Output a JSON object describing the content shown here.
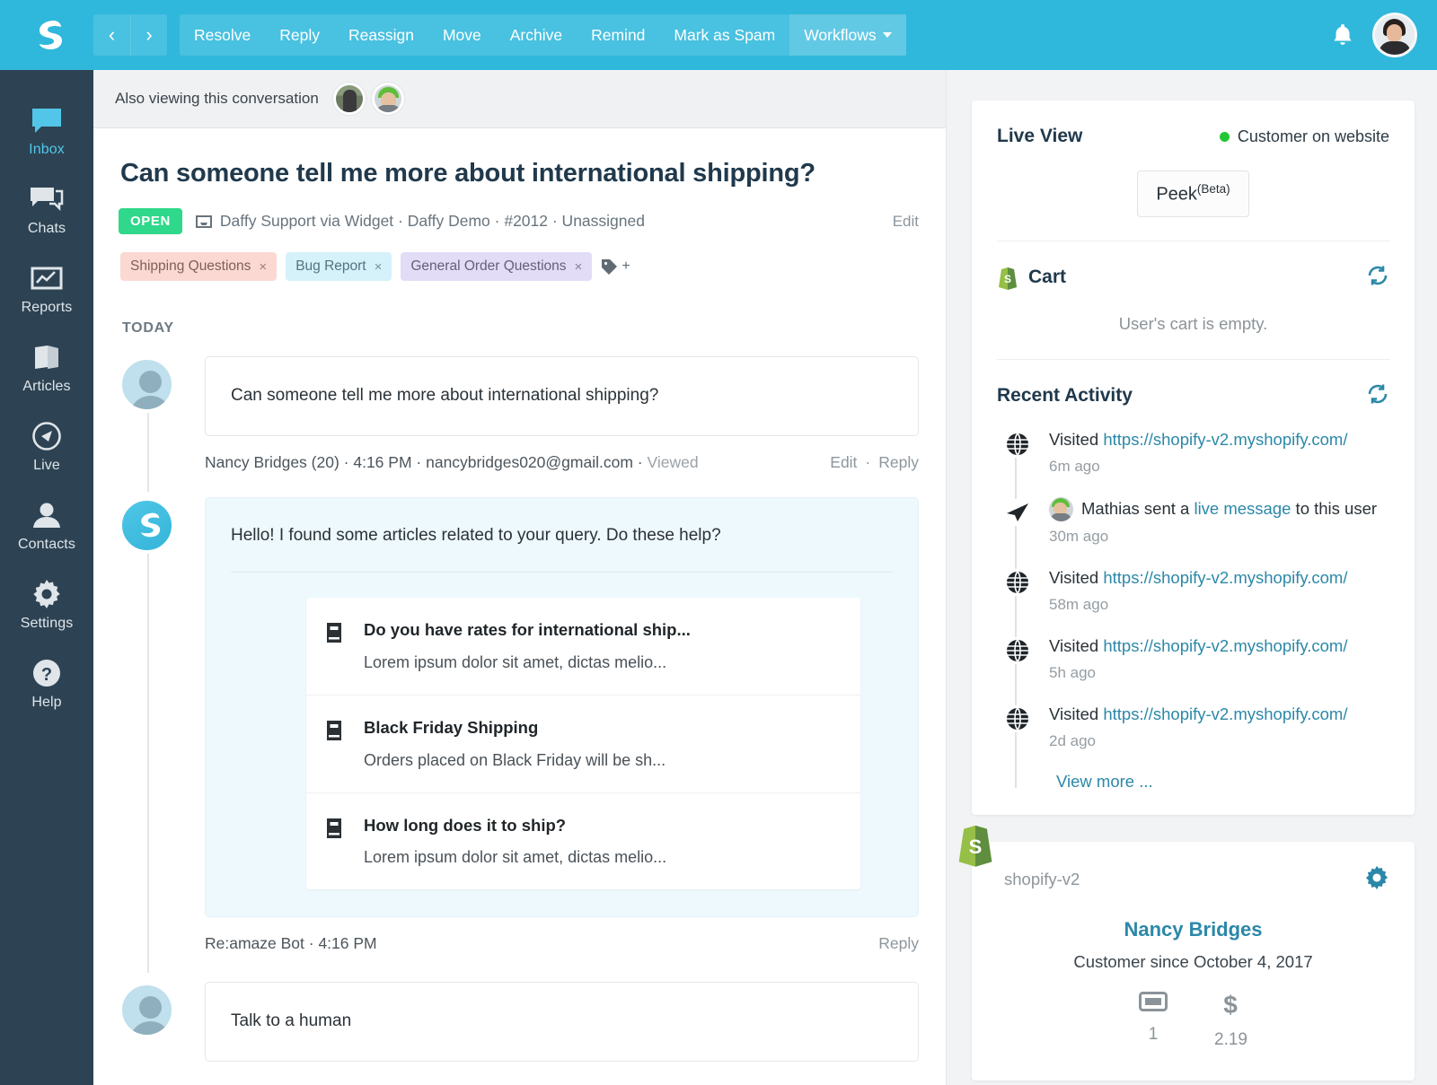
{
  "topbar": {
    "logo_icon": "reamaze-logo-icon",
    "prev_label": "‹",
    "next_label": "›",
    "actions": [
      {
        "label": "Resolve",
        "name": "resolve"
      },
      {
        "label": "Reply",
        "name": "reply"
      },
      {
        "label": "Reassign",
        "name": "reassign"
      },
      {
        "label": "Move",
        "name": "move"
      },
      {
        "label": "Archive",
        "name": "archive"
      },
      {
        "label": "Remind",
        "name": "remind"
      },
      {
        "label": "Mark as Spam",
        "name": "mark-as-spam"
      },
      {
        "label": "Workflows",
        "name": "workflows"
      }
    ],
    "bell_icon": "bell-icon",
    "avatar_icon": "user-avatar",
    "bg_color": "#2fb8dc"
  },
  "sidebar": {
    "bg_color": "#2d4354",
    "active_color": "#52c6e8",
    "items": [
      {
        "label": "Inbox",
        "icon": "inbox-chat-icon",
        "active": true
      },
      {
        "label": "Chats",
        "icon": "chats-icon",
        "active": false
      },
      {
        "label": "Reports",
        "icon": "reports-chart-icon",
        "active": false
      },
      {
        "label": "Articles",
        "icon": "articles-book-icon",
        "active": false
      },
      {
        "label": "Live",
        "icon": "live-compass-icon",
        "active": false
      },
      {
        "label": "Contacts",
        "icon": "contacts-person-icon",
        "active": false
      },
      {
        "label": "Settings",
        "icon": "gear-icon",
        "active": false
      },
      {
        "label": "Help",
        "icon": "help-question-icon",
        "active": false
      }
    ]
  },
  "viewing": {
    "label": "Also viewing this conversation",
    "viewer_count": 2
  },
  "conversation": {
    "title": "Can someone tell me more about international shipping?",
    "status_badge": "OPEN",
    "status_color": "#2fd88a",
    "meta": "Daffy Support via Widget · Daffy Demo · #2012 · Unassigned",
    "meta_icon": "inbox-tray-icon",
    "edit_label": "Edit",
    "tags": [
      {
        "label": "Shipping Questions",
        "bg": "#fbd9d2",
        "fg": "#7d6058",
        "close": "×"
      },
      {
        "label": "Bug Report",
        "bg": "#d5f1fa",
        "fg": "#52747f",
        "close": "×"
      },
      {
        "label": "General Order Questions",
        "bg": "#e3dcf7",
        "fg": "#645f7a",
        "close": "×"
      }
    ],
    "tag_add_icon": "tag-plus-icon",
    "tag_add_label": "+",
    "day_separator": "TODAY",
    "messages": [
      {
        "type": "customer",
        "avatar_icon": "customer-avatar",
        "text": "Can someone tell me more about international shipping?",
        "author": "Nancy Bridges (20)",
        "time": "4:16 PM",
        "email": "nancybridges020@gmail.com",
        "viewed": "Viewed",
        "actions": [
          "Edit",
          "Reply"
        ]
      },
      {
        "type": "bot",
        "avatar_icon": "reamaze-bot-avatar",
        "text": "Hello! I found some articles related to your query. Do these help?",
        "articles": [
          {
            "icon": "article-book-icon",
            "title": "Do you have rates for international ship...",
            "snippet": "Lorem ipsum dolor sit amet, dictas melio..."
          },
          {
            "icon": "article-book-icon",
            "title": "Black Friday Shipping",
            "snippet": "Orders placed on Black Friday will be sh..."
          },
          {
            "icon": "article-book-icon",
            "title": "How long does it to ship?",
            "snippet": "Lorem ipsum dolor sit amet, dictas melio..."
          }
        ],
        "author": "Re:amaze Bot",
        "time": "4:16 PM",
        "actions": [
          "Reply"
        ]
      },
      {
        "type": "customer",
        "avatar_icon": "customer-avatar",
        "text": "Talk to a human"
      }
    ]
  },
  "live_view": {
    "title": "Live View",
    "status": "Customer on website",
    "status_dot_color": "#25c633",
    "peek_label": "Peek",
    "peek_beta": "(Beta)",
    "cart": {
      "title": "Cart",
      "icon": "shopify-bag-icon",
      "refresh_icon": "refresh-icon",
      "empty_text": "User's cart is empty."
    },
    "recent_activity": {
      "title": "Recent Activity",
      "refresh_icon": "refresh-icon",
      "items": [
        {
          "icon": "globe-icon",
          "prefix": "Visited ",
          "link": "https://shopify-v2.myshopify.com/",
          "suffix": "",
          "time": "6m ago"
        },
        {
          "icon": "send-plane-icon",
          "avatar": true,
          "prefix": "Mathias sent a ",
          "link": "live message",
          "suffix": " to this user",
          "time": "30m ago"
        },
        {
          "icon": "globe-icon",
          "prefix": "Visited ",
          "link": "https://shopify-v2.myshopify.com/",
          "suffix": "",
          "time": "58m ago"
        },
        {
          "icon": "globe-icon",
          "prefix": "Visited ",
          "link": "https://shopify-v2.myshopify.com/",
          "suffix": "",
          "time": "5h ago"
        },
        {
          "icon": "globe-icon",
          "prefix": "Visited ",
          "link": "https://shopify-v2.myshopify.com/",
          "suffix": "",
          "time": "2d ago"
        }
      ],
      "view_more": "View more ..."
    }
  },
  "shopify_panel": {
    "badge_icon": "shopify-bag-icon",
    "store_name": "shopify-v2",
    "gear_icon": "gear-icon",
    "customer_name": "Nancy Bridges",
    "customer_since": "Customer since October 4, 2017",
    "stats": [
      {
        "icon": "orders-ticket-icon",
        "value": "1"
      },
      {
        "icon": "dollar-icon",
        "value": "2.19"
      }
    ]
  }
}
